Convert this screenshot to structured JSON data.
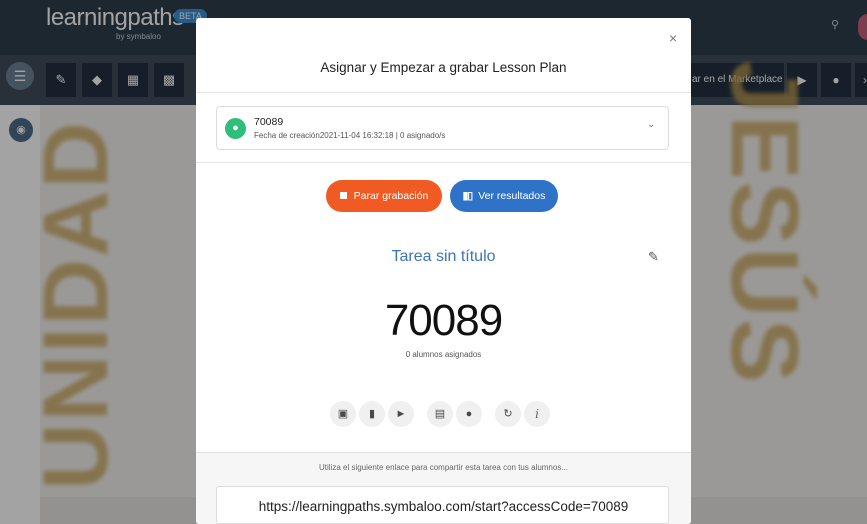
{
  "app": {
    "logo": "learningpaths",
    "logo_sub": "by symbaloo",
    "beta": "BETA",
    "marketplace_label": "ar en el Marketplace",
    "canvas_text_left": "UNIDAD",
    "canvas_text_right": "JESÚS"
  },
  "modal": {
    "title": "Asignar y Empezar a grabar Lesson Plan",
    "close": "×",
    "plan": {
      "code": "70089",
      "meta": "Fecha de creación2021-11-04 16:32:18 | 0 asignado/s"
    },
    "buttons": {
      "stop": "Parar grabación",
      "results": "Ver resultados"
    },
    "task_title": "Tarea sin título",
    "access_code": "70089",
    "students": "0 alumnos asignados",
    "share_label": "Utiliza el siguiente enlace para compartir esta tarea con tus alumnos...",
    "share_link": "https://learningpaths.symbaloo.com/start?accessCode=70089"
  },
  "colors": {
    "stop_button": "#f15a22",
    "results_button": "#2f73c8",
    "plan_badge": "#2ec07a",
    "task_title": "#3b75b8"
  }
}
